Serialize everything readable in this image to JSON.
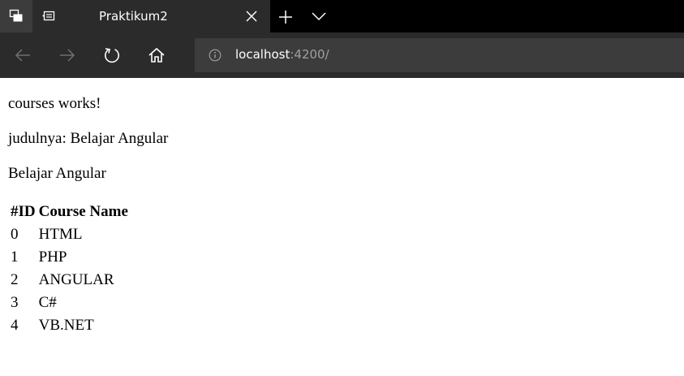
{
  "browser": {
    "tab": {
      "title": "Praktikum2"
    },
    "address": {
      "host": "localhost",
      "rest": ":4200/"
    }
  },
  "content": {
    "line1": "courses works!",
    "line2": "judulnya: Belajar Angular",
    "line3": "Belajar Angular",
    "table": {
      "headers": [
        "#ID",
        "Course Name"
      ],
      "rows": [
        {
          "id": "0",
          "name": "HTML"
        },
        {
          "id": "1",
          "name": "PHP"
        },
        {
          "id": "2",
          "name": "ANGULAR"
        },
        {
          "id": "3",
          "name": "C#"
        },
        {
          "id": "4",
          "name": "VB.NET"
        }
      ]
    }
  },
  "icons": {
    "tab_actions": "tab-actions-icon",
    "set_aside": "set-aside-tabs-icon",
    "close": "close-icon",
    "new_tab": "plus-icon",
    "tabs_menu": "chevron-down-icon",
    "back": "back-arrow-icon",
    "forward": "forward-arrow-icon",
    "refresh": "refresh-icon",
    "home": "home-icon",
    "info": "info-icon"
  },
  "colors": {
    "tabbar_bg": "#000000",
    "chrome_bg": "#2b2b2b",
    "address_bg": "#3c3c3c",
    "url_host": "#ffffff",
    "url_rest": "#a0a0a0",
    "page_bg": "#ffffff",
    "page_text": "#000000"
  }
}
